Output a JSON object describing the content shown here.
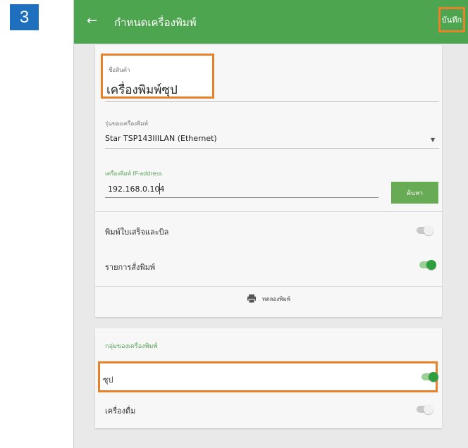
{
  "step_number": "3",
  "appbar": {
    "back_icon": "arrow-left-icon",
    "title": "กำหนดเครื่องพิมพ์",
    "save_label": "บันทึก",
    "color": "#4ea54f"
  },
  "form": {
    "product_name_label": "ชื่อสินค้า",
    "product_name_value": "เครื่องพิมพ์ซุป",
    "model_label": "รุ่นของเครื่องพิมพ์",
    "model_value": "Star TSP143IIILAN (Ethernet)",
    "ip_label": "เครื่องพิมพ์ IP-address",
    "ip_value": "192.168.0.104",
    "search_label": "ค้นหา"
  },
  "toggles": [
    {
      "label": "พิมพ์ใบเสร็จและบิล",
      "on": false
    },
    {
      "label": "รายการสั่งพิมพ์",
      "on": true
    }
  ],
  "test_print": {
    "icon": "printer-icon",
    "label": "ทดลองพิมพ์"
  },
  "groups": {
    "header": "กลุ่มของเครื่องพิมพ์",
    "items": [
      {
        "label": "ซุป",
        "on": true
      },
      {
        "label": "เครื่องดื่ม",
        "on": false
      }
    ]
  },
  "colors": {
    "accent": "#4ea54f",
    "highlight": "#e8822a",
    "badge": "#1f6fbf"
  }
}
